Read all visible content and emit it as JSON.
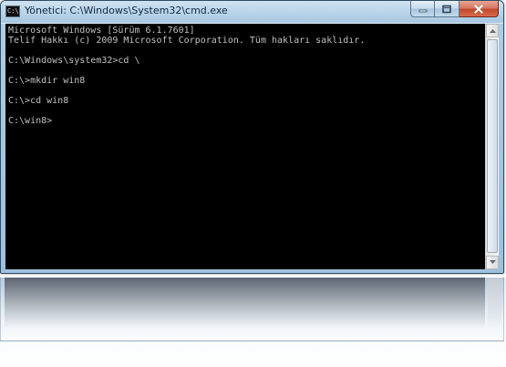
{
  "window": {
    "title": "Yönetici: C:\\Windows\\System32\\cmd.exe",
    "app_icon_label": "C:\\",
    "controls": [
      {
        "name": "minimize",
        "icon": "minimize-icon"
      },
      {
        "name": "maximize",
        "icon": "maximize-icon"
      },
      {
        "name": "close",
        "icon": "close-icon"
      }
    ]
  },
  "console": {
    "lines": [
      "Microsoft Windows [Sürüm 6.1.7601]",
      "Telif Hakkı (c) 2009 Microsoft Corporation. Tüm hakları saklıdır.",
      "",
      "C:\\Windows\\system32>cd \\",
      "",
      "C:\\>mkdir win8",
      "",
      "C:\\>cd win8",
      "",
      "C:\\win8>"
    ]
  },
  "scrollbar": {
    "up_icon": "scroll-up-arrow-icon",
    "down_icon": "scroll-down-arrow-icon"
  },
  "colors": {
    "console_background": "#000000",
    "console_text": "#c0c0c0",
    "close_button": "#c2472b",
    "frame": "#aecce4"
  }
}
